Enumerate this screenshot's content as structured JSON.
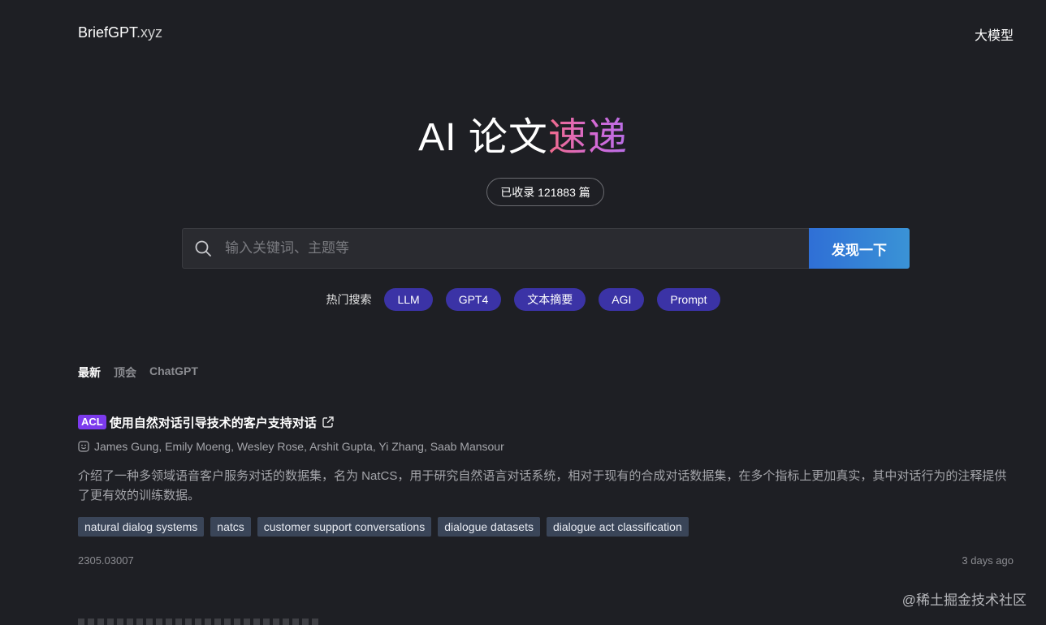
{
  "header": {
    "logo_main": "BriefGPT",
    "logo_tld": ".xyz",
    "nav_link": "大模型"
  },
  "hero": {
    "title_plain": "AI 论文",
    "title_highlight": "速递",
    "count_text": "已收录 121883 篇"
  },
  "search": {
    "placeholder": "输入关键词、主题等",
    "value": "",
    "button_label": "发现一下"
  },
  "hot": {
    "label": "热门搜索",
    "tags": [
      "LLM",
      "GPT4",
      "文本摘要",
      "AGI",
      "Prompt"
    ]
  },
  "tabs": [
    {
      "label": "最新",
      "active": true
    },
    {
      "label": "顶会",
      "active": false
    },
    {
      "label": "ChatGPT",
      "active": false
    }
  ],
  "paper": {
    "venue": "ACL",
    "title": "使用自然对话引导技术的客户支持对话",
    "authors": "James Gung, Emily Moeng, Wesley Rose, Arshit Gupta, Yi Zhang, Saab Mansour",
    "abstract": "介绍了一种多领域语音客户服务对话的数据集，名为 NatCS，用于研究自然语言对话系统，相对于现有的合成对话数据集，在多个指标上更加真实，其中对话行为的注释提供了更有效的训练数据。",
    "keywords": [
      "natural dialog systems",
      "natcs",
      "customer support conversations",
      "dialogue datasets",
      "dialogue act classification"
    ],
    "arxiv_id": "2305.03007",
    "time": "3 days ago"
  },
  "watermark": "@稀土掘金技术社区",
  "colors": {
    "background": "#1e1f24",
    "hot_tag": "#3b33a6",
    "venue_badge": "#7c3aed",
    "keyword_bg": "#3a4558",
    "button_gradient_start": "#2f6fd6",
    "button_gradient_end": "#3a93d6"
  },
  "icons": {
    "search": "search-icon",
    "external_link": "external-link-icon",
    "authors": "smiley-face-icon"
  }
}
